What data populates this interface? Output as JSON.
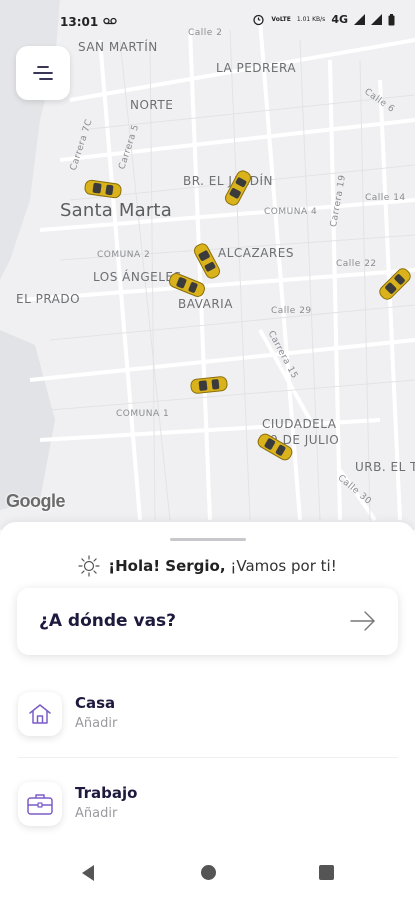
{
  "status_bar": {
    "time": "13:01",
    "network": "4G",
    "volte": "VoLTE",
    "speed": "1.01 KB/s"
  },
  "map": {
    "labels": {
      "san_martin": "SAN MARTÍN",
      "calle2": "Calle 2",
      "la_pedrera": "LA PEDRERA",
      "norte": "NORTE",
      "calle6": "Calle 6",
      "carrera7c": "Carrera 7C",
      "carrera5": "Carrera 5",
      "br_el_jardin": "BR. EL JARDÍN",
      "carrera19": "Carrera 19",
      "calle14": "Calle 14",
      "santa_marta": "Santa Marta",
      "comuna4": "COMUNA 4",
      "comuna2": "COMUNA 2",
      "alcazares": "ALCAZARES",
      "calle22": "Calle 22",
      "los_angeles": "LOS ÁNGELES",
      "el_prado": "EL PRADO",
      "bavaria": "BAVARIA",
      "calle29": "Calle 29",
      "carrera15": "Carrera 15",
      "comuna1": "COMUNA 1",
      "ciudadela": "CIUDADELA",
      "de_julio": "29 DE JULIO",
      "urb": "URB. EL T",
      "calle30": "Calle 30"
    },
    "google_logo": "Google"
  },
  "menu_icon": "menu-icon",
  "sheet": {
    "greeting_prefix": "¡Hola! Sergio,",
    "greeting_suffix": "¡Vamos por ti!",
    "where_label": "¿A dónde vas?",
    "places": [
      {
        "title": "Casa",
        "subtitle": "Añadir",
        "icon": "home-icon"
      },
      {
        "title": "Trabajo",
        "subtitle": "Añadir",
        "icon": "briefcase-icon"
      }
    ]
  },
  "colors": {
    "accent": "#7b5cc9",
    "taxi": "#d9b21c",
    "text_dark": "#1e1a3e"
  }
}
